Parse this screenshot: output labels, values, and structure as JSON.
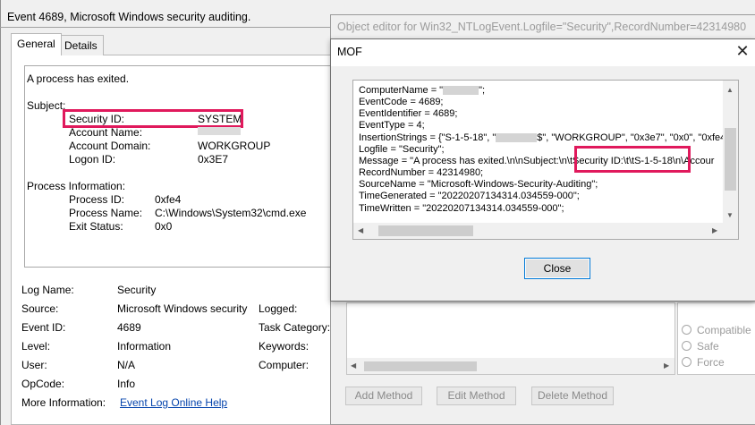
{
  "event_window": {
    "title": "Event 4689, Microsoft Windows security auditing.",
    "tabs": [
      "General",
      "Details"
    ],
    "message": {
      "intro": "A process has exited.",
      "subject_header": "Subject:",
      "security_id_label": "Security ID:",
      "security_id_value": "SYSTEM",
      "account_name_label": "Account Name:",
      "account_domain_label": "Account Domain:",
      "account_domain_value": "WORKGROUP",
      "logon_id_label": "Logon ID:",
      "logon_id_value": "0x3E7",
      "process_info_header": "Process Information:",
      "process_id_label": "Process ID:",
      "process_id_value": "0xfe4",
      "process_name_label": "Process Name:",
      "process_name_value": "C:\\Windows\\System32\\cmd.exe",
      "exit_status_label": "Exit Status:",
      "exit_status_value": "0x0"
    },
    "props": {
      "log_name_label": "Log Name:",
      "log_name_value": "Security",
      "source_label": "Source:",
      "source_value": "Microsoft Windows security",
      "logged_label": "Logged:",
      "event_id_label": "Event ID:",
      "event_id_value": "4689",
      "task_category_label": "Task Category:",
      "level_label": "Level:",
      "level_value": "Information",
      "keywords_label": "Keywords:",
      "user_label": "User:",
      "user_value": "N/A",
      "computer_label": "Computer:",
      "opcode_label": "OpCode:",
      "opcode_value": "Info",
      "more_info_label": "More Information:",
      "more_info_link": "Event Log Online Help"
    }
  },
  "object_editor": {
    "title": "Object editor for Win32_NTLogEvent.Logfile=\"Security\",RecordNumber=42314980",
    "radios": [
      "Compatible",
      "Safe",
      "Force"
    ],
    "buttons": [
      "Add Method",
      "Edit Method",
      "Delete Method"
    ]
  },
  "mof_dialog": {
    "title": "MOF",
    "close_glyph": "✕",
    "lines": {
      "computer_name": "ComputerName = \"",
      "computer_name_end": "\";",
      "event_code": "EventCode = 4689;",
      "event_identifier": "EventIdentifier = 4689;",
      "event_type": "EventType = 4;",
      "insertion_strings_a": "InsertionStrings = {\"S-1-5-18\", \"",
      "insertion_strings_b": "$\", \"WORKGROUP\", \"0x3e7\", \"0x0\", \"0xfe4",
      "logfile": "Logfile = \"Security\";",
      "message_a": "Message = \"A process has exited.\\n\\nSubject:\\n\\t",
      "message_hl": "Security ID:\\t\\tS-1-5-18\\n\\",
      "message_b": "Accour",
      "record_number": "RecordNumber = 42314980;",
      "source_name": "SourceName = \"Microsoft-Windows-Security-Auditing\";",
      "time_generated": "TimeGenerated = \"20220207134314.034559-000\";",
      "time_written": "TimeWritten = \"20220207134314.034559-000\";"
    },
    "close_button": "Close"
  },
  "colors": {
    "highlight": "#e0195c",
    "link": "#0645ad",
    "button_focus": "#0078d7"
  }
}
